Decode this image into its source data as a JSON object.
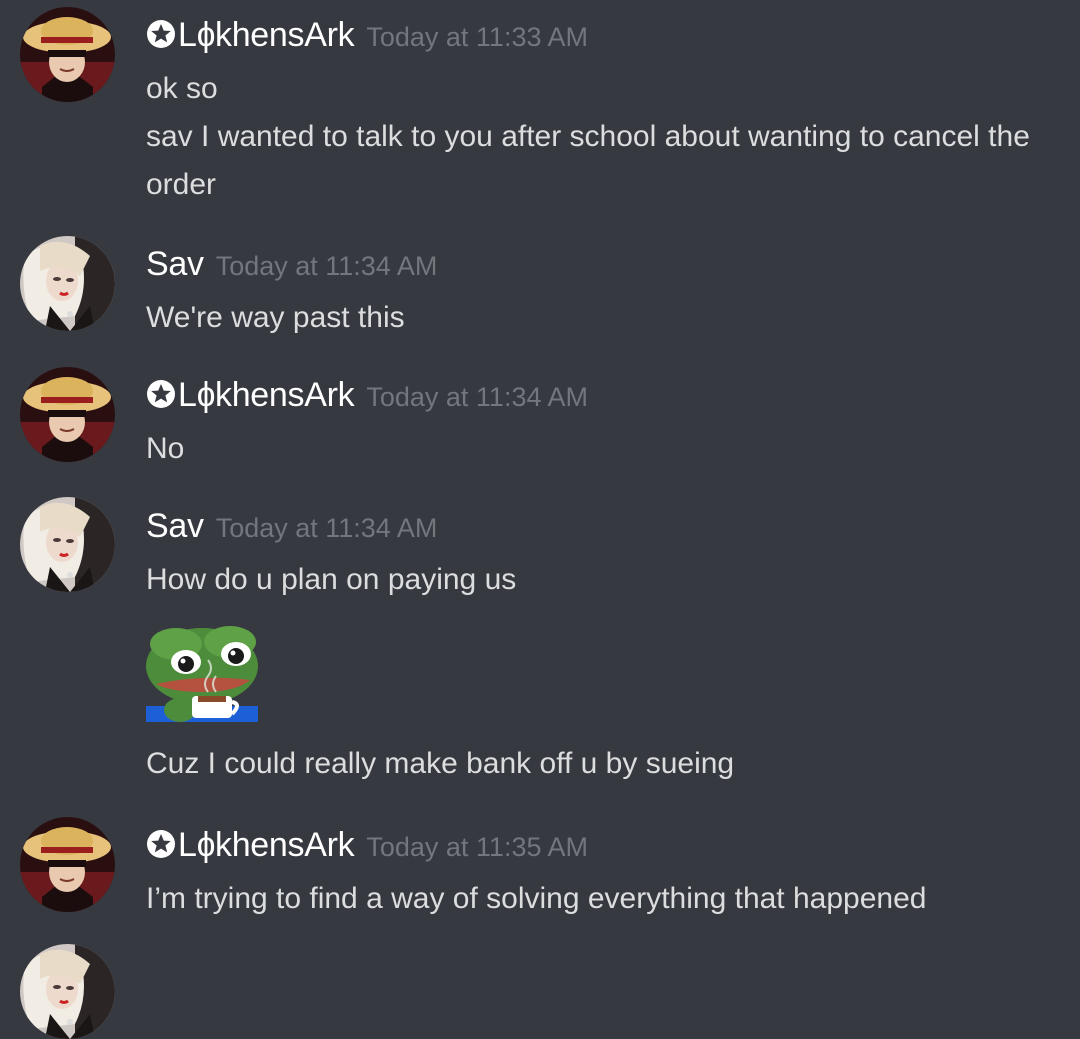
{
  "messages": [
    {
      "author": "✪LɸkhensArk",
      "author_badge": "star-circle-icon",
      "author_name_text": "LɸkhensArk",
      "timestamp": "Today at 11:33 AM",
      "lines": [
        "ok so",
        "sav I wanted to talk to you after school about wanting to cancel the order"
      ]
    },
    {
      "author": "Sav",
      "timestamp": "Today at 11:34 AM",
      "lines": [
        "We're way past this"
      ]
    },
    {
      "author": "✪LɸkhensArk",
      "author_name_text": "LɸkhensArk",
      "timestamp": "Today at 11:34 AM",
      "lines": [
        "No"
      ]
    },
    {
      "author": "Sav",
      "timestamp": "Today at 11:34 AM",
      "lines": [
        "How do u plan on paying us"
      ],
      "emoji": "crying-pepe-coffee-emoji",
      "followup": "Cuz I could really make bank off u by sueing"
    },
    {
      "author": "✪LɸkhensArk",
      "author_name_text": "LɸkhensArk",
      "timestamp": "Today at 11:35 AM",
      "lines": [
        "I’m trying to find a way of solving everything that happened"
      ]
    }
  ],
  "colors": {
    "background": "#36393f",
    "username": "#ffffff",
    "timestamp": "#72767d",
    "message_text": "#dcddde"
  }
}
